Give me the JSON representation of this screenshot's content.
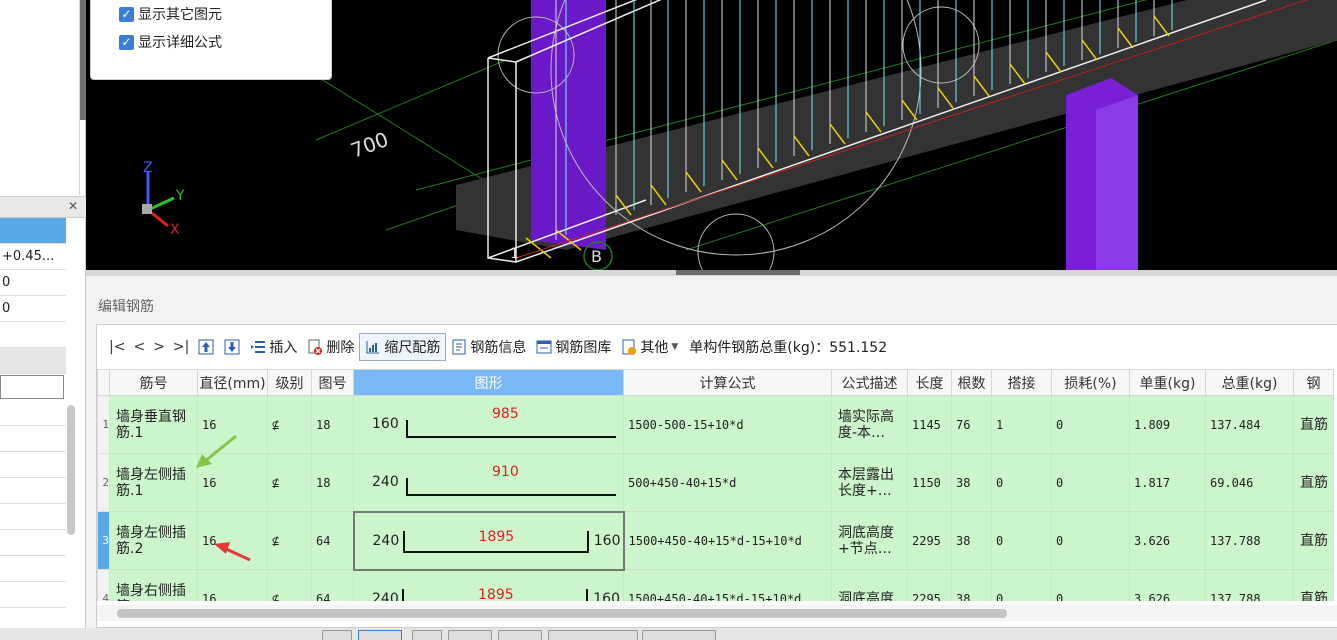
{
  "options": {
    "show_other_elements": "显示其它图元",
    "show_detailed_formula": "显示详细公式"
  },
  "left_panel": {
    "rows": [
      "",
      "+0.45...",
      "0",
      "0"
    ]
  },
  "viewport": {
    "dimension_label": "700",
    "axis_label_b": "B",
    "axis_label_1": "1",
    "axes": {
      "z": "Z",
      "y": "Y",
      "x": "X"
    }
  },
  "editor": {
    "title": "编辑钢筋",
    "toolbar": {
      "nav": [
        "|<",
        "<",
        ">",
        ">|"
      ],
      "insert": "插入",
      "delete": "删除",
      "scale_rebar": "缩尺配筋",
      "rebar_info": "钢筋信息",
      "rebar_library": "钢筋图库",
      "other": "其他",
      "total_weight": "单构件钢筋总重(kg)：551.152"
    },
    "columns": [
      "筋号",
      "直径(mm)",
      "级别",
      "图号",
      "图形",
      "计算公式",
      "公式描述",
      "长度",
      "根数",
      "搭接",
      "损耗(%)",
      "单重(kg)",
      "总重(kg)",
      "钢"
    ],
    "rows": [
      {
        "idx": "1",
        "name": "墙身垂直钢筋.1",
        "dia": "16",
        "grade": "⊈",
        "fig_no": "18",
        "left": "160",
        "mid": "985",
        "right": "",
        "formula": "1500-500-15+10*d",
        "desc": "墙实际高度-本…",
        "length": "1145",
        "count": "76",
        "lap": "1",
        "loss": "0",
        "unit_w": "1.809",
        "total_w": "137.484",
        "type": "直筋"
      },
      {
        "idx": "2",
        "name": "墙身左侧插筋.1",
        "dia": "16",
        "grade": "⊈",
        "fig_no": "18",
        "left": "240",
        "mid": "910",
        "right": "",
        "formula": "500+450-40+15*d",
        "desc": "本层露出长度+…",
        "length": "1150",
        "count": "38",
        "lap": "0",
        "loss": "0",
        "unit_w": "1.817",
        "total_w": "69.046",
        "type": "直筋"
      },
      {
        "idx": "3",
        "name": "墙身左侧插筋.2",
        "dia": "16",
        "grade": "⊈",
        "fig_no": "64",
        "left": "240",
        "mid": "1895",
        "right": "160",
        "formula": "1500+450-40+15*d-15+10*d",
        "desc": "洞底高度+节点…",
        "length": "2295",
        "count": "38",
        "lap": "0",
        "loss": "0",
        "unit_w": "3.626",
        "total_w": "137.788",
        "type": "直筋"
      },
      {
        "idx": "4",
        "name": "墙身右侧插筋",
        "dia": "16",
        "grade": "⊈",
        "fig_no": "64",
        "left": "240",
        "mid": "1895",
        "right": "160",
        "formula": "1500+450-40+15*d-15+10*d",
        "desc": "洞底高度",
        "length": "2295",
        "count": "38",
        "lap": "0",
        "loss": "0",
        "unit_w": "3.626",
        "total_w": "137.788",
        "type": "直筋"
      }
    ]
  },
  "colors": {
    "header_fig_bg": "#7ab8f5",
    "row_bg": "#ccf5cc",
    "dim_red": "#e02020",
    "arrow_green": "#8bc34a",
    "arrow_red": "#e53935",
    "purple": "#7a1fd6"
  }
}
